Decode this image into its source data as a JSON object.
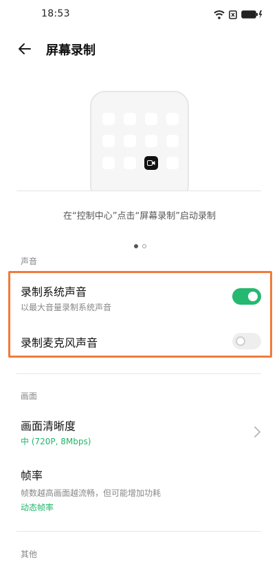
{
  "status_bar": {
    "time": "18:53"
  },
  "header": {
    "title": "屏幕录制"
  },
  "preview": {
    "caption": "在“控制中心”点击“屏幕录制”启动录制",
    "page_indicator": {
      "current": 1,
      "total": 2
    }
  },
  "sound": {
    "section_label": "声音",
    "system_sound": {
      "title": "录制系统声音",
      "subtitle": "以最大音量录制系统声音",
      "enabled": true
    },
    "mic_sound": {
      "title": "录制麦克风声音",
      "enabled": false
    }
  },
  "picture": {
    "section_label": "画面",
    "resolution": {
      "title": "画面清晰度",
      "value": "中 (720P, 8Mbps)"
    },
    "frame_rate": {
      "title": "帧率",
      "subtitle": "帧数越高画面越流畅，但可能增加功耗",
      "value": "动态帧率"
    }
  },
  "other": {
    "section_label": "其他"
  },
  "colors": {
    "accent": "#25b870",
    "highlight": "#f07a3a"
  },
  "icons": {
    "back": "arrow-left-icon",
    "record": "video-camera-icon",
    "chevron": "chevron-right-icon"
  }
}
